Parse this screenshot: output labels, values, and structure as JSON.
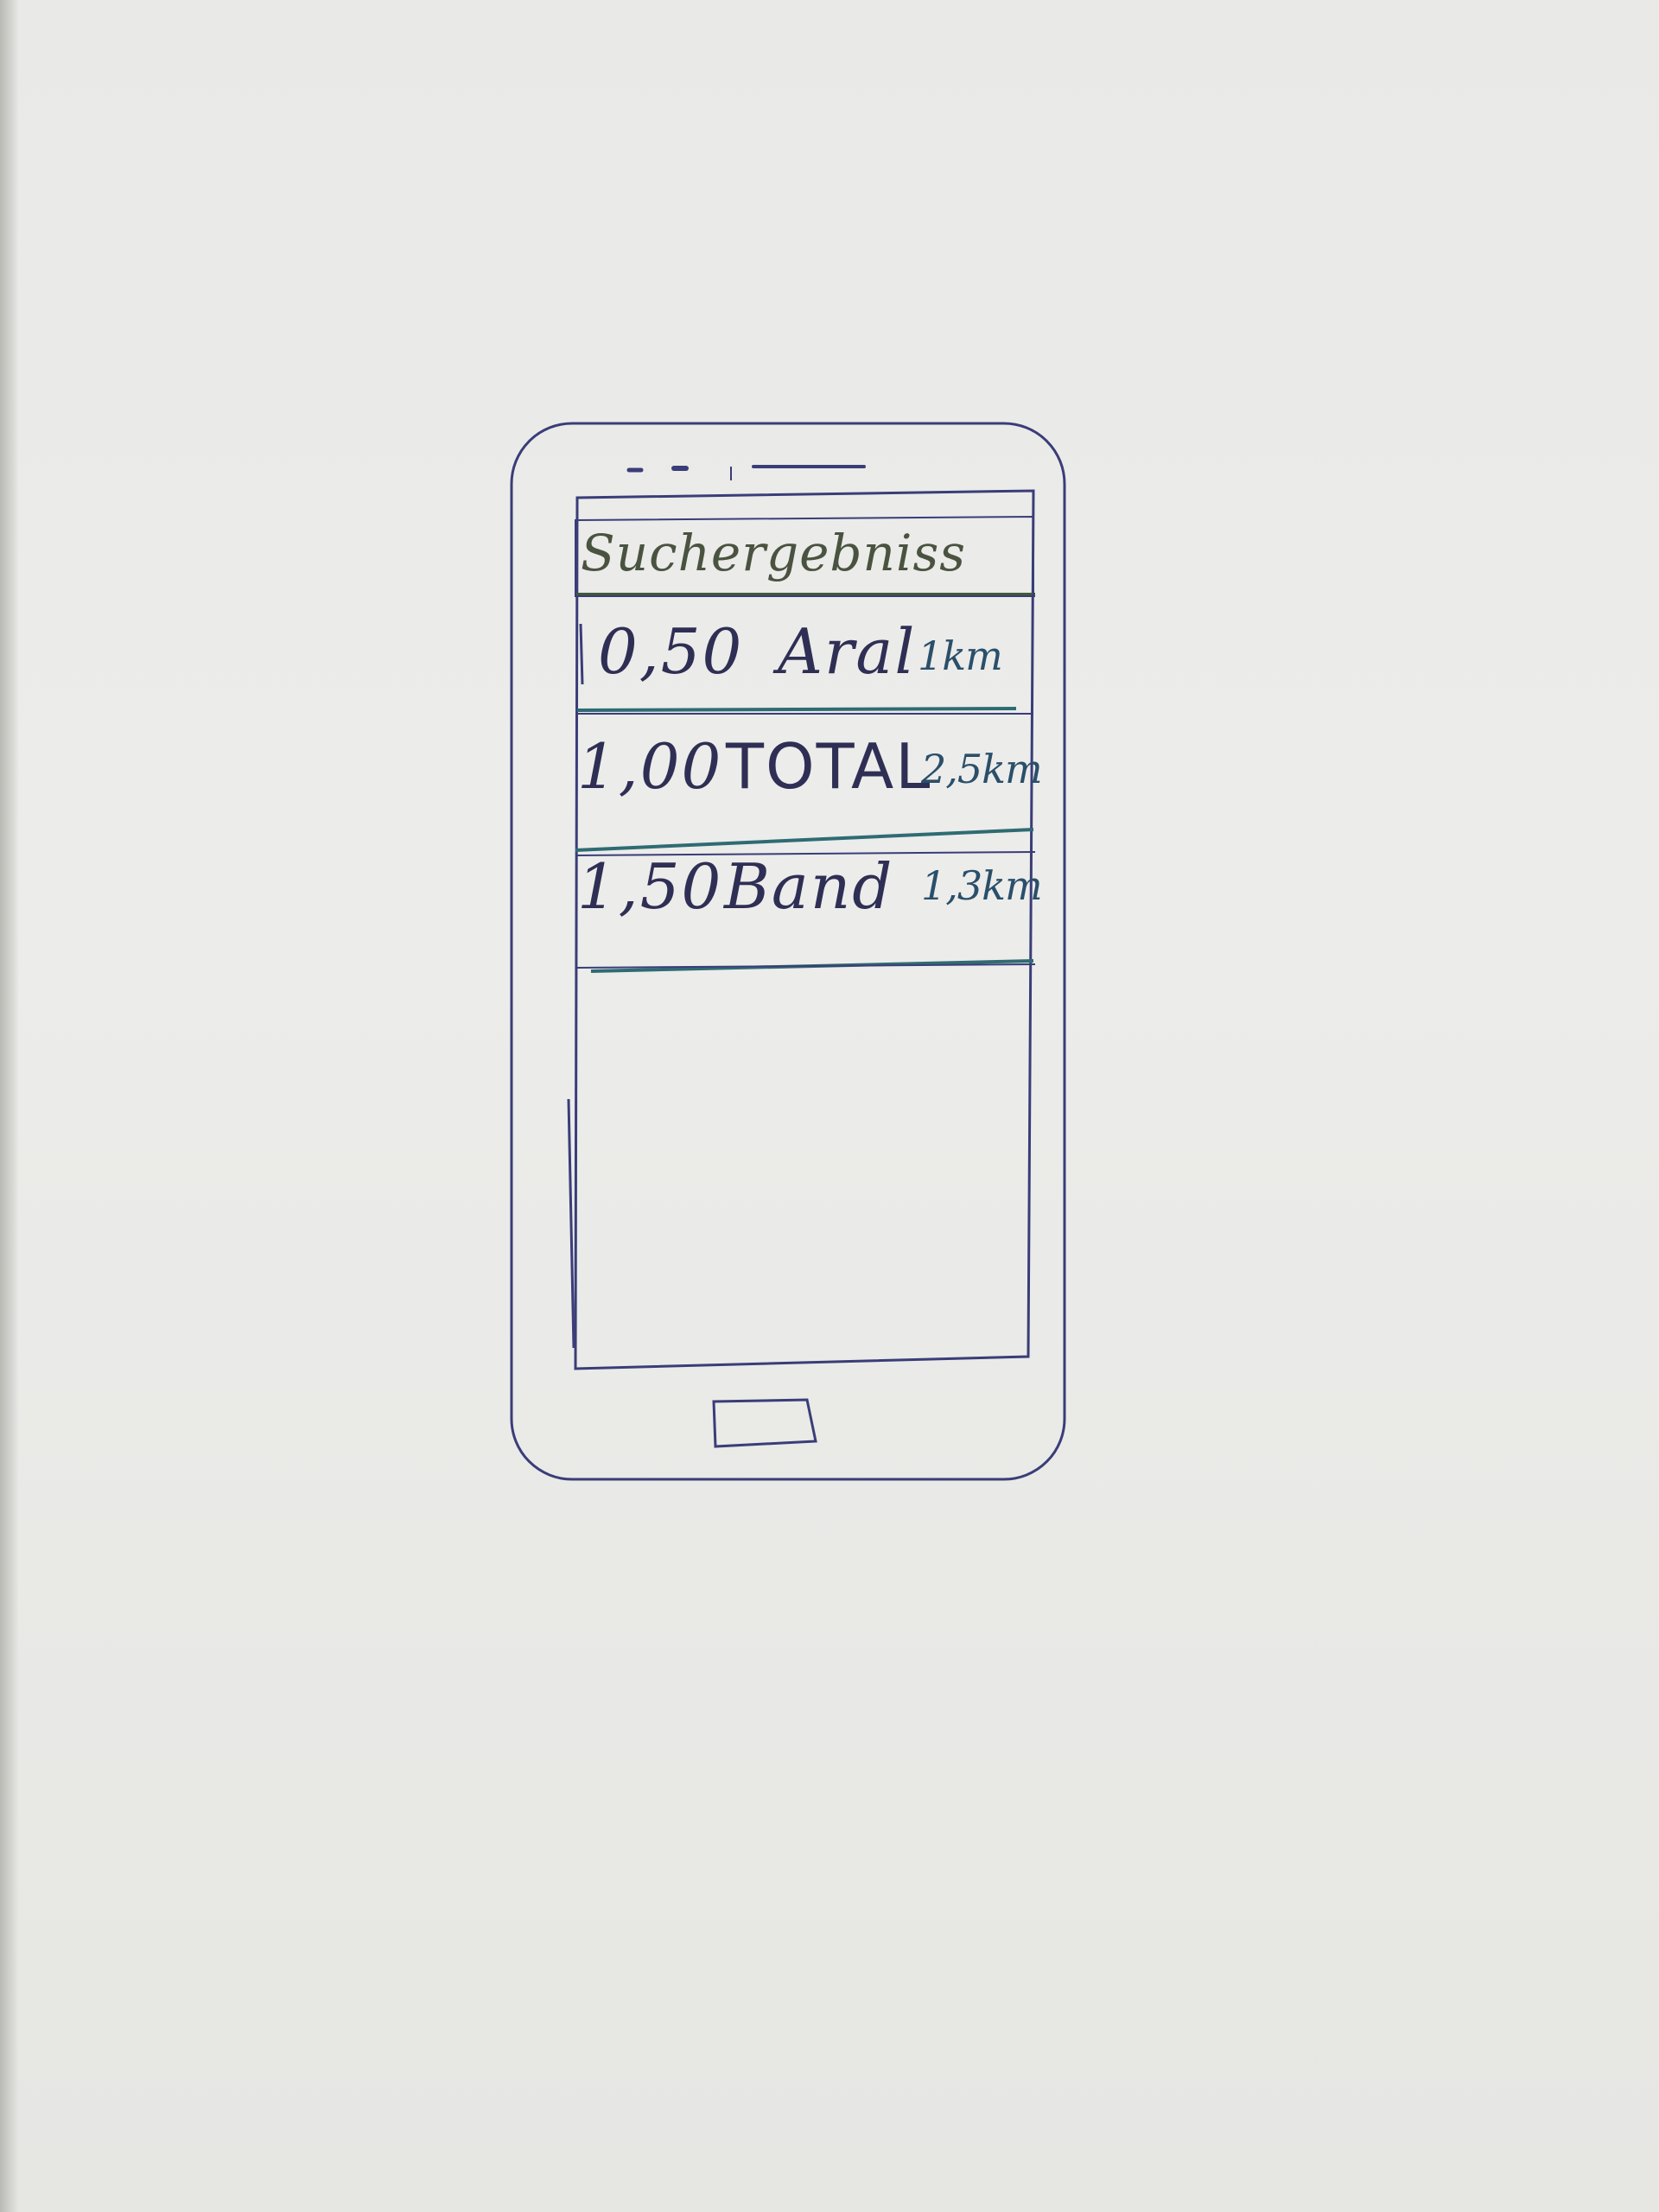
{
  "screen": {
    "title": "Suchergebniss"
  },
  "results": [
    {
      "price": "0,50",
      "name": "Aral",
      "distance": "1km"
    },
    {
      "price": "1,00",
      "name": "TOTAL",
      "distance": "2,5km"
    },
    {
      "price": "1,50",
      "name": "Band",
      "distance": "1,3km"
    }
  ],
  "colors": {
    "ink": "#3b3f6b",
    "accent_line": "#2f6b73",
    "paper": "#ececea"
  }
}
